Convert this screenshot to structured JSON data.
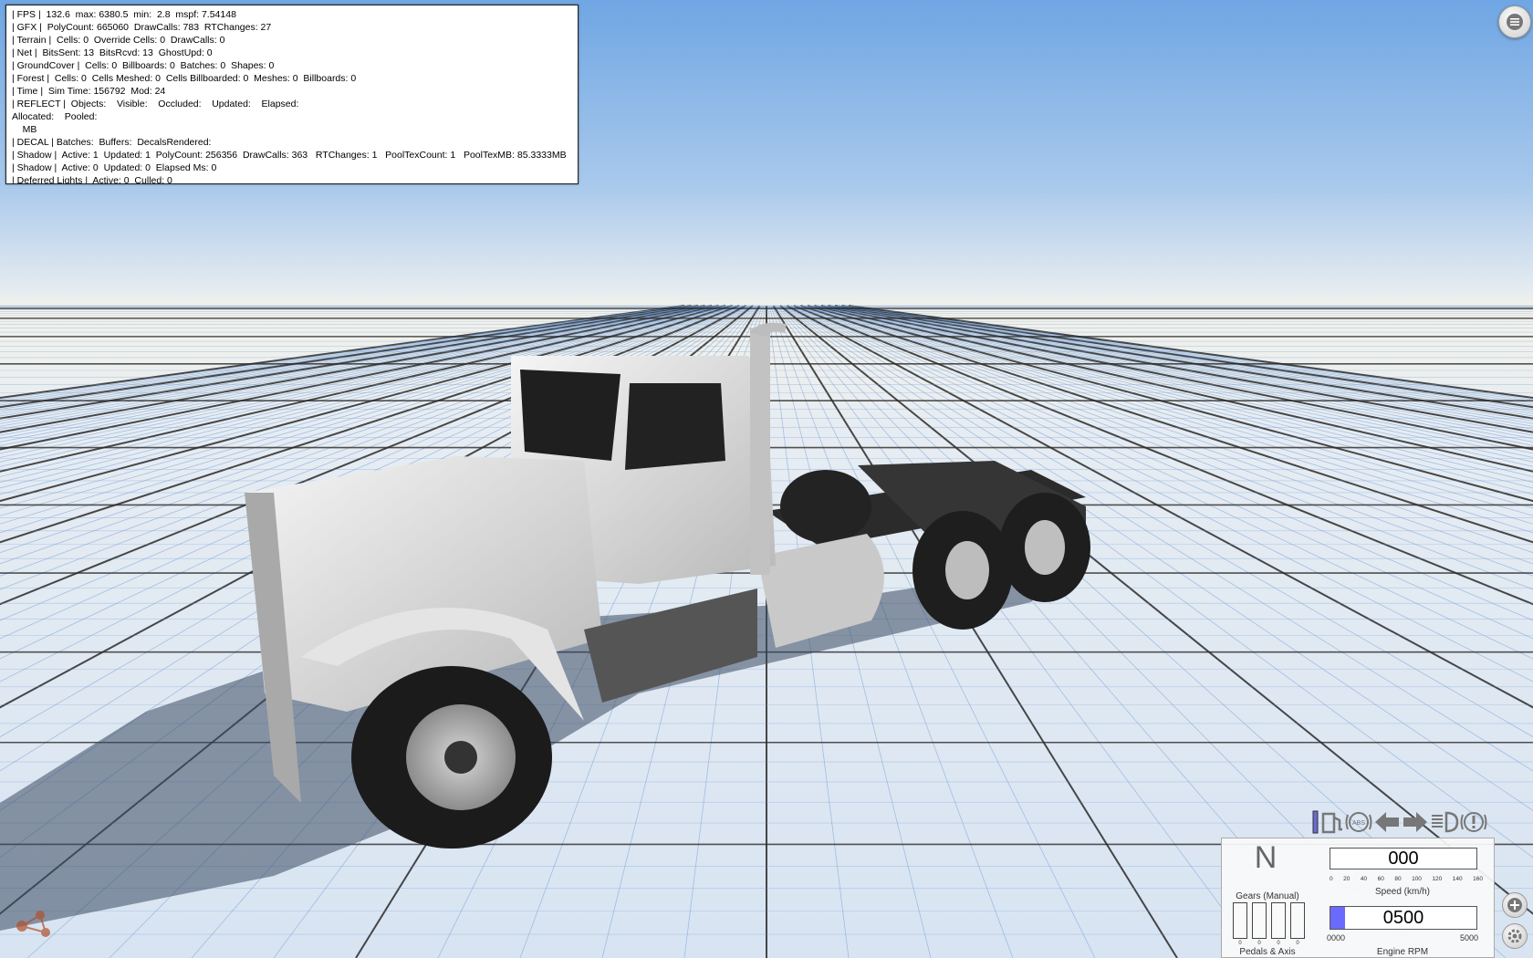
{
  "debug": {
    "lines": [
      "| FPS |  132.6  max: 6380.5  min:  2.8  mspf: 7.54148",
      "| GFX |  PolyCount: 665060  DrawCalls: 783  RTChanges: 27",
      "| Terrain |  Cells: 0  Override Cells: 0  DrawCalls: 0",
      "| Net |  BitsSent: 13  BitsRcvd: 13  GhostUpd: 0",
      "| GroundCover |  Cells: 0  Billboards: 0  Batches: 0  Shapes: 0",
      "| Forest |  Cells: 0  Cells Meshed: 0  Cells Billboarded: 0  Meshes: 0  Billboards: 0",
      "| Time |  Sim Time: 156792  Mod: 24",
      "| REFLECT |  Objects:    Visible:    Occluded:    Updated:    Elapsed:",
      "Allocated:    Pooled:",
      "    MB",
      "| DECAL | Batches:  Buffers:  DecalsRendered:",
      "| Shadow |  Active: 1  Updated: 1  PolyCount: 256356  DrawCalls: 363   RTChanges: 1   PoolTexCount: 1   PoolTexMB: 85.3333MB",
      "| Shadow |  Active: 0  Updated: 0  Elapsed Ms: 0",
      "| Deferred Lights |  Active: 0  Culled: 0"
    ]
  },
  "icons": [
    "menu-icon",
    "parking-brake-icon",
    "fuel-icon",
    "abs-icon",
    "left-signal-icon",
    "right-signal-icon",
    "high-beam-icon",
    "warning-icon",
    "zoom-in-icon",
    "settings-icon"
  ],
  "dashboard": {
    "gear": "N",
    "gear_label": "Gears (Manual)",
    "pedals_label": "Pedals & Axis",
    "pedal_values": [
      "0",
      "0",
      "0",
      "0"
    ],
    "speed_value": "000",
    "speed_label": "Speed (km/h)",
    "speed_ticks": [
      "0",
      "20",
      "40",
      "60",
      "80",
      "100",
      "120",
      "140",
      "160"
    ],
    "rpm_value": "0500",
    "rpm_label": "Engine RPM",
    "rpm_min": "0000",
    "rpm_max": "5000",
    "rpm_fraction": 0.1
  },
  "colors": {
    "sky_top": "#7fb0e6",
    "sky_horizon": "#f2f2ea",
    "ground": "#e8eef6",
    "grid_major": "#2a2a2a",
    "grid_minor": "#6f9bd6",
    "rpm_fill": "#6a6aff"
  }
}
